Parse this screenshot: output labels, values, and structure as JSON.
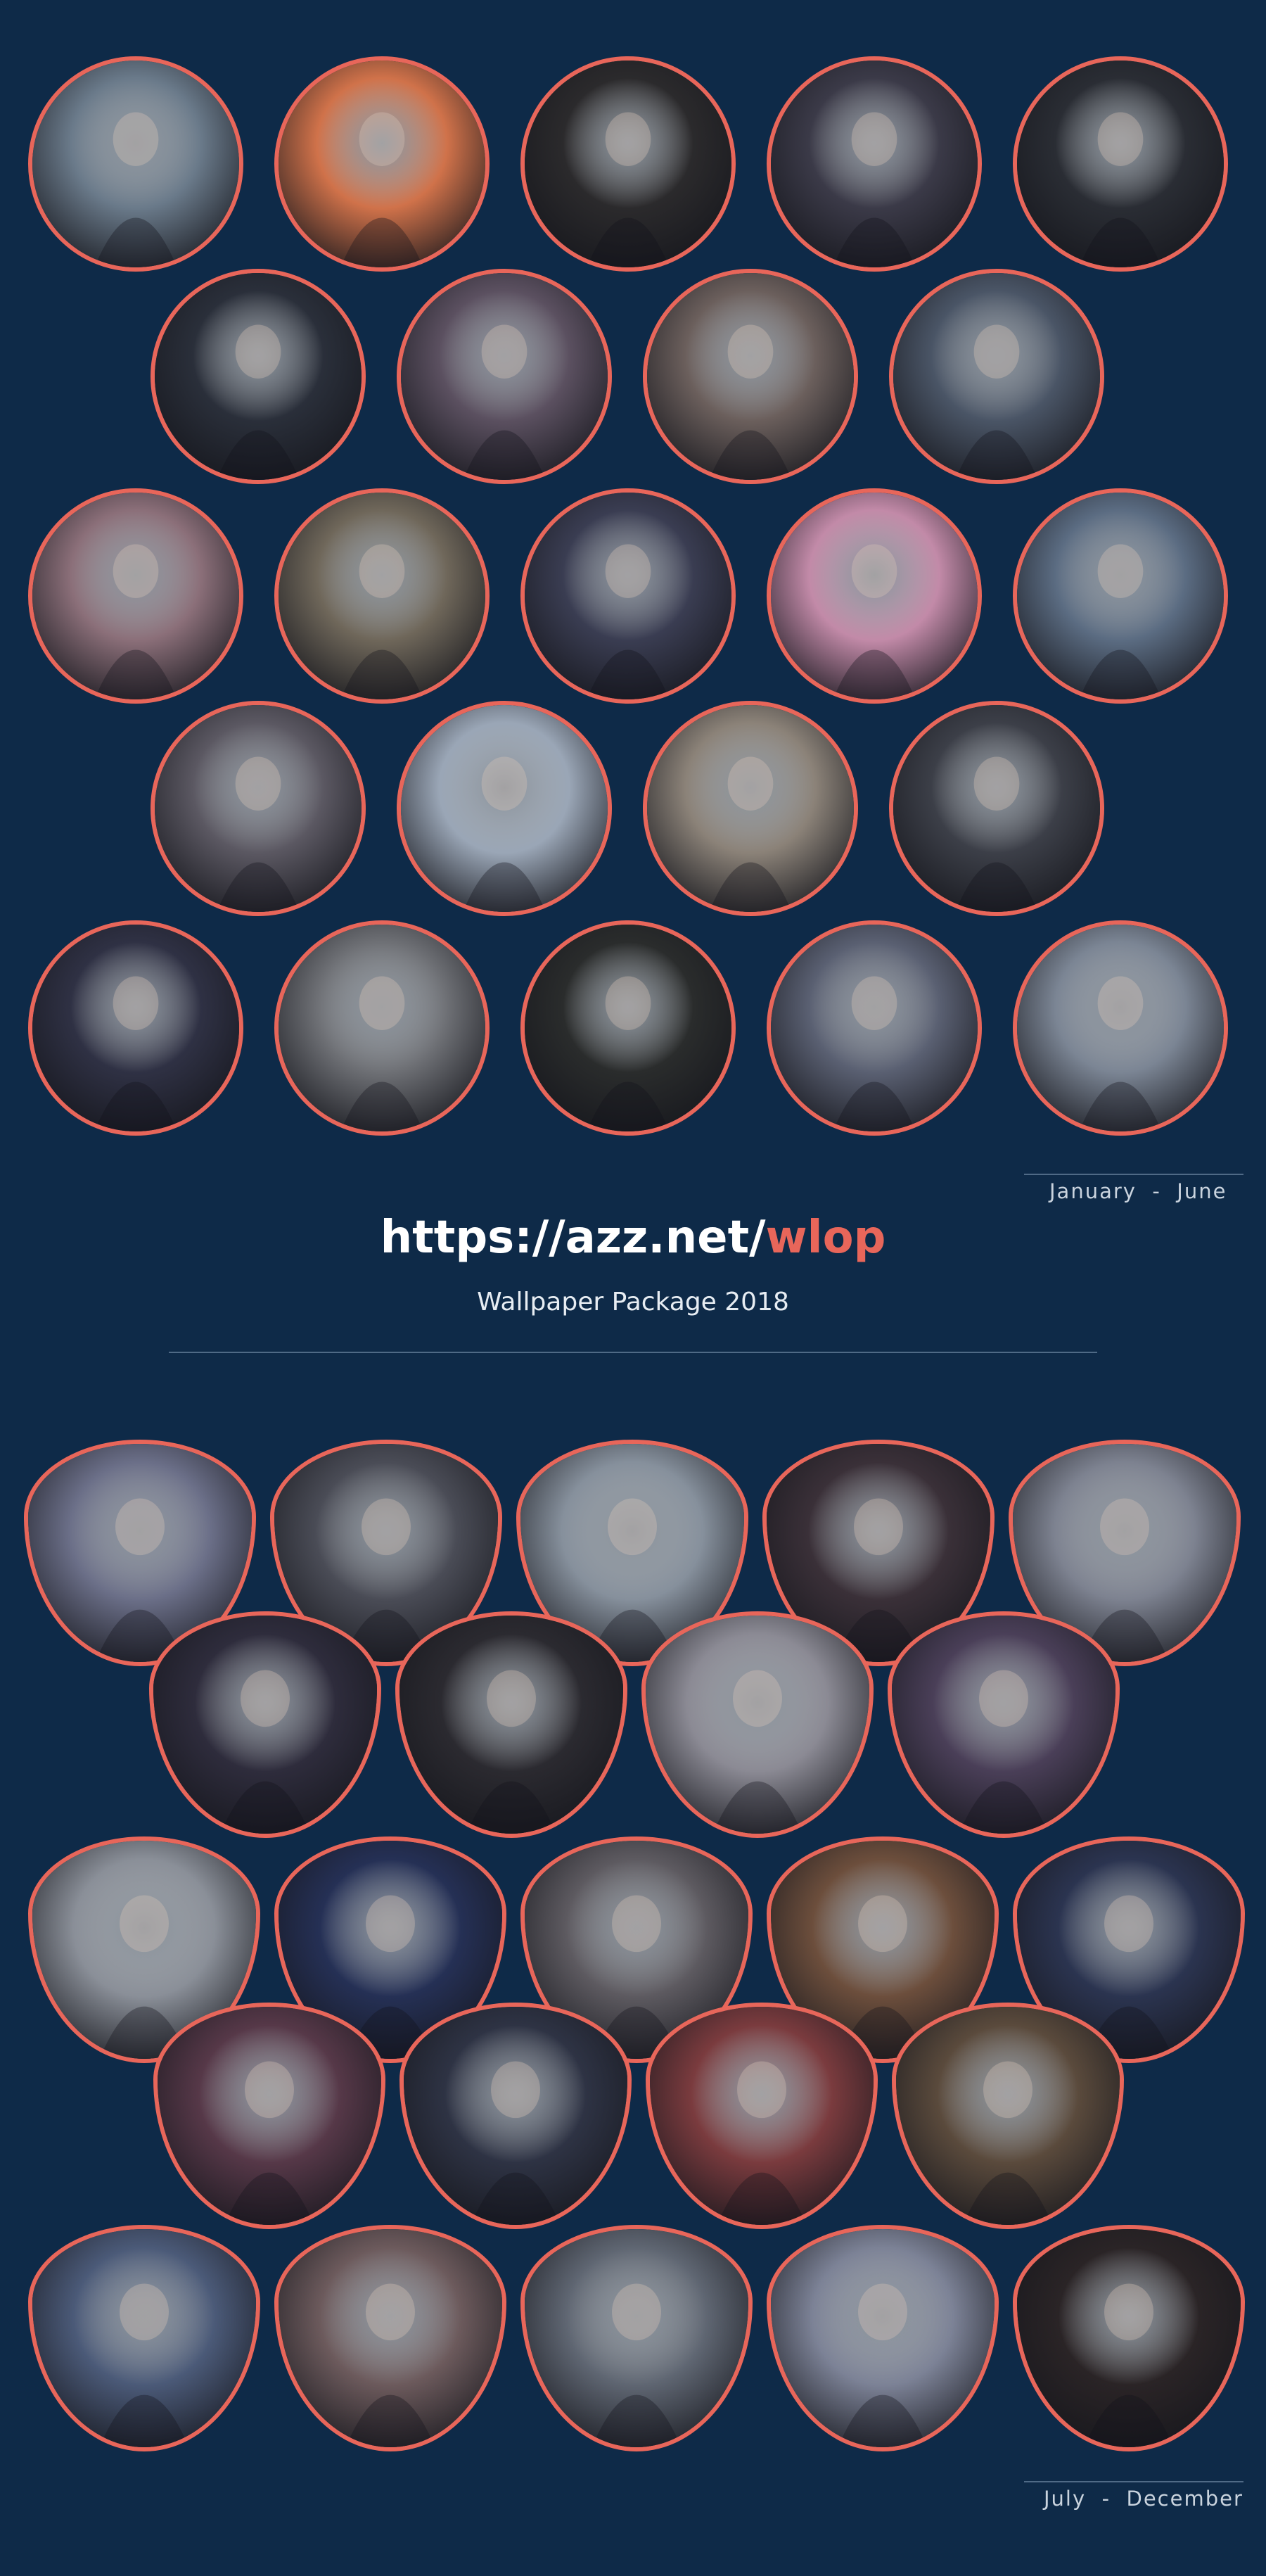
{
  "header": {
    "url_prefix": "https://azz.net/",
    "url_accent": "wlop",
    "subtitle": "Wallpaper Package 2018"
  },
  "sections": {
    "first_label": "January  -  June",
    "second_label": "July  -  December"
  },
  "colors": {
    "background": "#0e2a48",
    "frame": "#e8665a",
    "text": "#ffffff"
  },
  "thumbnails_first_half": [
    {
      "name": "thumb-1",
      "hue": "#6a7a8a"
    },
    {
      "name": "thumb-2",
      "hue": "#d0724a"
    },
    {
      "name": "thumb-3",
      "hue": "#2b2a2c"
    },
    {
      "name": "thumb-4",
      "hue": "#3b3a48"
    },
    {
      "name": "thumb-5",
      "hue": "#2a2d34"
    },
    {
      "name": "thumb-6",
      "hue": "#2a2f3a"
    },
    {
      "name": "thumb-7",
      "hue": "#5b5060"
    },
    {
      "name": "thumb-8",
      "hue": "#6b5f5c"
    },
    {
      "name": "thumb-9",
      "hue": "#4a5566"
    },
    {
      "name": "thumb-10",
      "hue": "#8b6f79"
    },
    {
      "name": "thumb-11",
      "hue": "#6f675a"
    },
    {
      "name": "thumb-12",
      "hue": "#3a3d52"
    },
    {
      "name": "thumb-13",
      "hue": "#c28aa8"
    },
    {
      "name": "thumb-14",
      "hue": "#5b6c82"
    },
    {
      "name": "thumb-15",
      "hue": "#5b5862"
    },
    {
      "name": "thumb-16",
      "hue": "#9aa6b6"
    },
    {
      "name": "thumb-17",
      "hue": "#8b8278"
    },
    {
      "name": "thumb-18",
      "hue": "#3c3f48"
    },
    {
      "name": "thumb-19",
      "hue": "#2f3144"
    },
    {
      "name": "thumb-20",
      "hue": "#6e7075"
    },
    {
      "name": "thumb-21",
      "hue": "#2a2c2c"
    },
    {
      "name": "thumb-22",
      "hue": "#5a6072"
    },
    {
      "name": "thumb-23",
      "hue": "#7b8594"
    }
  ],
  "thumbnails_second_half": [
    {
      "name": "thumb-24",
      "hue": "#6b6f88"
    },
    {
      "name": "thumb-25",
      "hue": "#4a4c56"
    },
    {
      "name": "thumb-26",
      "hue": "#86909c"
    },
    {
      "name": "thumb-27",
      "hue": "#3a3038"
    },
    {
      "name": "thumb-28",
      "hue": "#7d8290"
    },
    {
      "name": "thumb-29",
      "hue": "#2e2c3c"
    },
    {
      "name": "thumb-30",
      "hue": "#2b2a30"
    },
    {
      "name": "thumb-31",
      "hue": "#8b8a94"
    },
    {
      "name": "thumb-32",
      "hue": "#4a3f58"
    },
    {
      "name": "thumb-33",
      "hue": "#8a8f98"
    },
    {
      "name": "thumb-34",
      "hue": "#253055"
    },
    {
      "name": "thumb-35",
      "hue": "#5d5a60"
    },
    {
      "name": "thumb-36",
      "hue": "#6c4e3c"
    },
    {
      "name": "thumb-37",
      "hue": "#2b3450"
    },
    {
      "name": "thumb-38",
      "hue": "#563848"
    },
    {
      "name": "thumb-39",
      "hue": "#2e3344"
    },
    {
      "name": "thumb-40",
      "hue": "#7a3b3e"
    },
    {
      "name": "thumb-41",
      "hue": "#5a4a3c"
    },
    {
      "name": "thumb-42",
      "hue": "#4b5a78"
    },
    {
      "name": "thumb-43",
      "hue": "#6c5a5c"
    },
    {
      "name": "thumb-44",
      "hue": "#5f6672"
    },
    {
      "name": "thumb-45",
      "hue": "#7c8296"
    },
    {
      "name": "thumb-46",
      "hue": "#2a2426"
    }
  ]
}
